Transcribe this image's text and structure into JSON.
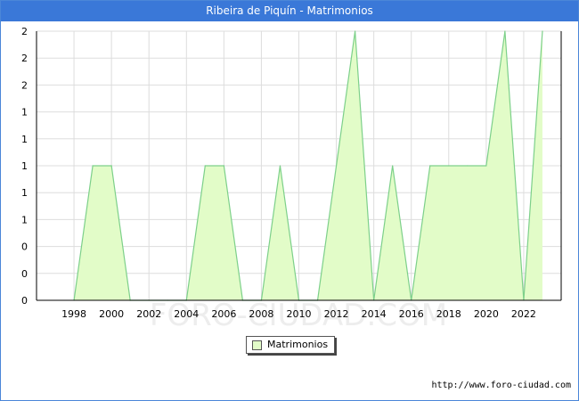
{
  "title": "Ribeira de Piquín - Matrimonios",
  "watermark": "FORO-CIUDAD.COM",
  "source_url": "http://www.foro-ciudad.com",
  "colors": {
    "header": "#3a78d8",
    "fill": "#e2fcc8",
    "line": "#7dd08a",
    "grid": "#dddddd"
  },
  "chart_data": {
    "type": "area",
    "x": [
      1998,
      1999,
      2000,
      2001,
      2002,
      2003,
      2004,
      2005,
      2006,
      2007,
      2008,
      2009,
      2010,
      2011,
      2012,
      2013,
      2014,
      2015,
      2016,
      2017,
      2018,
      2019,
      2020,
      2021,
      2022,
      2023
    ],
    "series": [
      {
        "name": "Matrimonios",
        "values": [
          0,
          1,
          1,
          0,
          0,
          0,
          0,
          1,
          1,
          0,
          0,
          1,
          0,
          0,
          1,
          2,
          0,
          1,
          0,
          1,
          1,
          1,
          1,
          2,
          0,
          2
        ]
      }
    ],
    "x_ticks": [
      1998,
      2000,
      2002,
      2004,
      2006,
      2008,
      2010,
      2012,
      2014,
      2016,
      2018,
      2020,
      2022
    ],
    "y_tick_labels": [
      "0",
      "0",
      "0",
      "1",
      "1",
      "1",
      "1",
      "1",
      "2",
      "2",
      "2"
    ],
    "xlim": [
      1996,
      2024
    ],
    "ylim": [
      0,
      2
    ],
    "grid": true,
    "legend_position": "bottom-center"
  }
}
